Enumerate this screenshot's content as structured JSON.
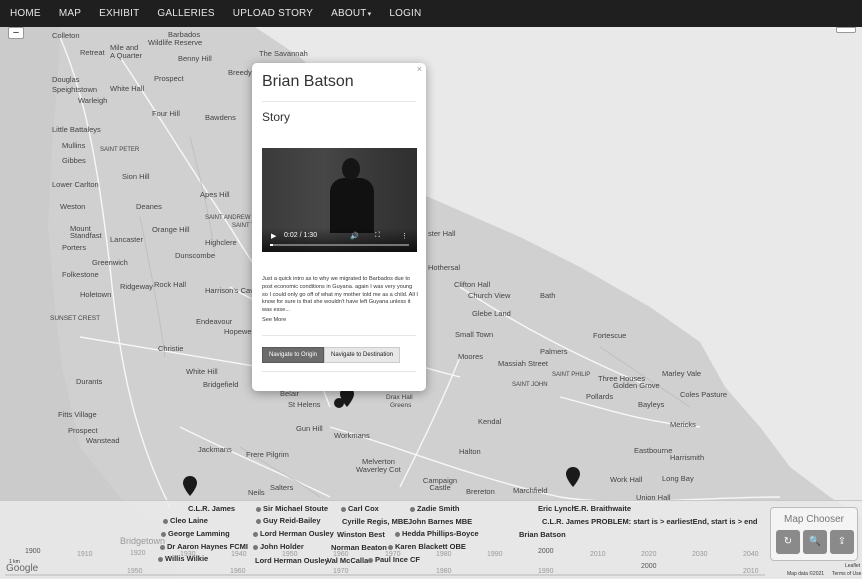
{
  "nav": {
    "items": [
      "HOME",
      "MAP",
      "EXHIBIT",
      "GALLERIES",
      "UPLOAD STORY",
      "ABOUT",
      "LOGIN"
    ],
    "about_caret": "▾"
  },
  "map": {
    "zoom_minus": "−",
    "places": [
      {
        "t": "Colleton"
      },
      {
        "t": "Barbados"
      },
      {
        "t": "Wildlife Reserve"
      },
      {
        "t": "Retreat"
      },
      {
        "t": "Mile and"
      },
      {
        "t": "A Quarter"
      },
      {
        "t": "Benny Hill"
      },
      {
        "t": "The Savannah"
      },
      {
        "t": "Breedy"
      },
      {
        "t": "Douglas"
      },
      {
        "t": "Prospect"
      },
      {
        "t": "Speightstown"
      },
      {
        "t": "White Hall"
      },
      {
        "t": "Warleigh"
      },
      {
        "t": "Four Hill"
      },
      {
        "t": "Bawdens"
      },
      {
        "t": "Little Battaleys"
      },
      {
        "t": "Mullins"
      },
      {
        "t": "SAINT PETER"
      },
      {
        "t": "Gibbes"
      },
      {
        "t": "SAINT ANDREW"
      },
      {
        "t": "Sion Hill"
      },
      {
        "t": "Lower Carlton"
      },
      {
        "t": "Apes Hill"
      },
      {
        "t": "Weston"
      },
      {
        "t": "Deanes"
      },
      {
        "t": "Mount Standfast"
      },
      {
        "t": "Lancaster"
      },
      {
        "t": "Orange Hill"
      },
      {
        "t": "Highclere"
      },
      {
        "t": "Porters"
      },
      {
        "t": "Dunscombe"
      },
      {
        "t": "Greenwich"
      },
      {
        "t": "Folkestone"
      },
      {
        "t": "Rock Hall"
      },
      {
        "t": "Ridgeway"
      },
      {
        "t": "Holetown"
      },
      {
        "t": "Harrison's Cav"
      },
      {
        "t": "SUNSET CREST"
      },
      {
        "t": "Endeavour"
      },
      {
        "t": "Hopewell"
      },
      {
        "t": "Christie"
      },
      {
        "t": "White Hill"
      },
      {
        "t": "Durants"
      },
      {
        "t": "Bridgefield"
      },
      {
        "t": "Fitts Village"
      },
      {
        "t": "Prospect"
      },
      {
        "t": "Wanstead"
      },
      {
        "t": "Jackmans"
      },
      {
        "t": "Gun Hill"
      },
      {
        "t": "Workmans"
      },
      {
        "t": "St Helens"
      },
      {
        "t": "Drax Hall"
      },
      {
        "t": "Greens"
      },
      {
        "t": "Frere Pilgrim"
      },
      {
        "t": "Melverton"
      },
      {
        "t": "Waverley Cot"
      },
      {
        "t": "Campaign Castle"
      },
      {
        "t": "Brereton"
      },
      {
        "t": "Marchfield"
      },
      {
        "t": "Salters"
      },
      {
        "t": "Neils"
      },
      {
        "t": "Halton"
      },
      {
        "t": "Eastbourne"
      },
      {
        "t": "Harrismith"
      },
      {
        "t": "Work Hall"
      },
      {
        "t": "Long Bay"
      },
      {
        "t": "Union Hall"
      },
      {
        "t": "Kendal"
      },
      {
        "t": "Mericks"
      },
      {
        "t": "Bayleys"
      },
      {
        "t": "Coles Pasture"
      },
      {
        "t": "Pollards"
      },
      {
        "t": "Three Houses"
      },
      {
        "t": "Golden Grove"
      },
      {
        "t": "Marley Vale"
      },
      {
        "t": "Massiah Street"
      },
      {
        "t": "Palmers"
      },
      {
        "t": "Moores"
      },
      {
        "t": "Fortescue"
      },
      {
        "t": "Small Town"
      },
      {
        "t": "Glebe Land"
      },
      {
        "t": "Church View"
      },
      {
        "t": "Clifton Hall"
      },
      {
        "t": "Bath"
      },
      {
        "t": "Hothersal"
      },
      {
        "t": "ster Hall"
      },
      {
        "t": "SAINT JOHN"
      },
      {
        "t": "SAINT PHILIP"
      },
      {
        "t": "Belair"
      },
      {
        "t": "SAINT THOMAS"
      }
    ]
  },
  "popup": {
    "close": "×",
    "name": "Brian Batson",
    "section": "Story",
    "video": {
      "play": "▶",
      "time": "0:02 / 1:30",
      "volume": "🔊",
      "fullscreen": "⛶",
      "more": "⋮",
      "progress": 0.022
    },
    "story": "Just a quick intro as to why we migrated to Barbados due to post economic conditions in Guyana. again I was very young so I could only go off of what my mother told me as a child. All I know for sure is that she wouldn't have left Guyana unless it was esse...",
    "see_more": "See More",
    "btn_origin": "Navigate to Origin",
    "btn_destination": "Navigate to Destination"
  },
  "timeline": {
    "names": [
      {
        "t": "C.L.R. James",
        "bold": true,
        "dot": false
      },
      {
        "t": "Sir Michael Stoute",
        "bold": true,
        "dot": true
      },
      {
        "t": "Carl Cox",
        "bold": true,
        "dot": true
      },
      {
        "t": "Zadie Smith",
        "bold": true,
        "dot": true
      },
      {
        "t": "Eric Lynch",
        "bold": true,
        "dot": false
      },
      {
        "t": "E.R. Braithwaite",
        "bold": true,
        "dot": false
      },
      {
        "t": "Cleo Laine",
        "bold": true,
        "dot": true
      },
      {
        "t": "Guy Reid-Bailey",
        "bold": true,
        "dot": true
      },
      {
        "t": "Cyrille Regis, MBE",
        "bold": true,
        "dot": false
      },
      {
        "t": "John Barnes MBE",
        "bold": true,
        "dot": false
      },
      {
        "t": "C.L.R. James PROBLEM: start is > earliestEnd, start is > end",
        "bold": true,
        "dot": false
      },
      {
        "t": "George Lamming",
        "bold": true,
        "dot": true
      },
      {
        "t": "Lord Herman Ousley",
        "bold": true,
        "dot": true
      },
      {
        "t": "Winston Best",
        "bold": true,
        "dot": false
      },
      {
        "t": "Hedda Phillips-Boyce",
        "bold": true,
        "dot": true
      },
      {
        "t": "Brian Batson",
        "bold": true,
        "dot": false
      },
      {
        "t": "Dr Aaron Haynes FCMI",
        "bold": true,
        "dot": true
      },
      {
        "t": "John Holder",
        "bold": true,
        "dot": true
      },
      {
        "t": "Norman Beaton",
        "bold": true,
        "dot": false
      },
      {
        "t": "Karen Blackett OBE",
        "bold": true,
        "dot": true
      },
      {
        "t": "Willis Wilkie",
        "bold": true,
        "dot": true
      },
      {
        "t": "Lord Herman Ousley",
        "bold": true,
        "dot": false
      },
      {
        "t": "Val McCalla",
        "bold": true,
        "dot": false
      },
      {
        "t": "Paul Ince CF",
        "bold": true,
        "dot": true
      }
    ],
    "years_major": [
      "1900",
      "1920",
      "1940",
      "1960",
      "1980",
      "2000",
      "2020",
      "2040"
    ],
    "years_minor": [
      "1910",
      "1930",
      "1950",
      "1970",
      "1990",
      "2010",
      "2030"
    ],
    "years_bottom": [
      "1950",
      "1960",
      "1970",
      "1980",
      "1990",
      "2000",
      "2010"
    ],
    "scale": "1 km",
    "bridgetown": "Bridgetown",
    "google": "Google",
    "attribution": "Map data ©2021",
    "terms": "Terms of Use",
    "leaflet": "Leaflet"
  },
  "map_chooser": {
    "title": "Map Chooser",
    "buttons": [
      "↻",
      "🔍",
      "⇪"
    ]
  }
}
